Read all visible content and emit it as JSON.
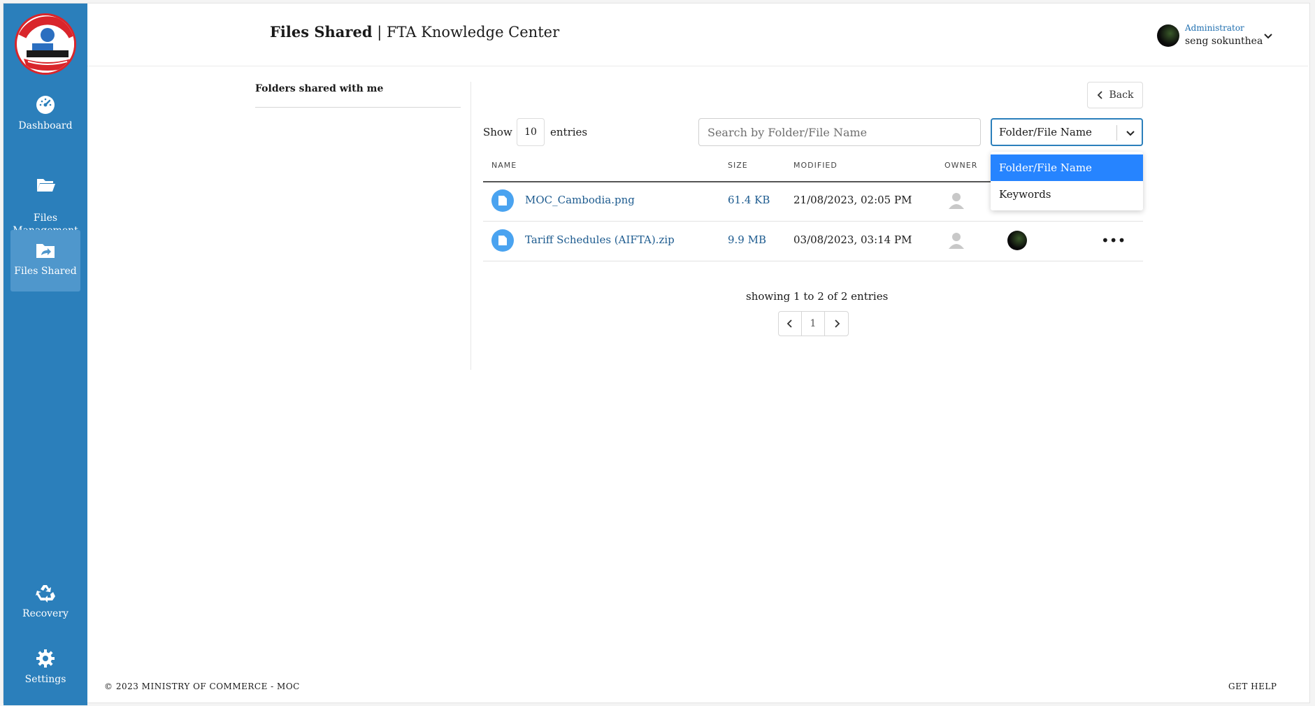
{
  "header": {
    "title_strong": "Files Shared",
    "title_rest": " | FTA Knowledge Center",
    "user_role": "Administrator",
    "user_name": "seng sokunthea"
  },
  "sidebar": {
    "items": [
      {
        "label": "Dashboard",
        "icon": "dashboard-icon"
      },
      {
        "label": "Files\nManagement",
        "icon": "folder-open-icon"
      },
      {
        "label": "Files Shared",
        "icon": "shared-folder-icon",
        "active": true
      },
      {
        "label": "Recovery",
        "icon": "recycle-icon"
      },
      {
        "label": "Settings",
        "icon": "gear-icon"
      }
    ]
  },
  "left_panel": {
    "title": "Folders shared with me"
  },
  "toolbar": {
    "back_label": "Back",
    "show_label": "Show",
    "entries_value": "10",
    "entries_label": "entries",
    "search_placeholder": "Search by Folder/File Name",
    "search_by_selected": "Folder/File Name",
    "search_by_options": [
      "Folder/File Name",
      "Keywords"
    ]
  },
  "table": {
    "columns": [
      "NAME",
      "SIZE",
      "MODIFIED",
      "OWNER"
    ],
    "rows": [
      {
        "name": "MOC_Cambodia.png",
        "size": "61.4 KB",
        "modified": "21/08/2023, 02:05 PM"
      },
      {
        "name": "Tariff Schedules (AIFTA).zip",
        "size": "9.9 MB",
        "modified": "03/08/2023, 03:14 PM"
      }
    ]
  },
  "pagination": {
    "summary": "showing 1 to 2 of 2 entries",
    "current_page": "1"
  },
  "footer": {
    "copyright": "© 2023 MINISTRY OF COMMERCE - MOC",
    "help": "GET HELP"
  },
  "colors": {
    "sidebar": "#2b7fbb",
    "accent": "#2684ff",
    "link": "#1d5b8f",
    "file_icon": "#4aa3f0"
  }
}
